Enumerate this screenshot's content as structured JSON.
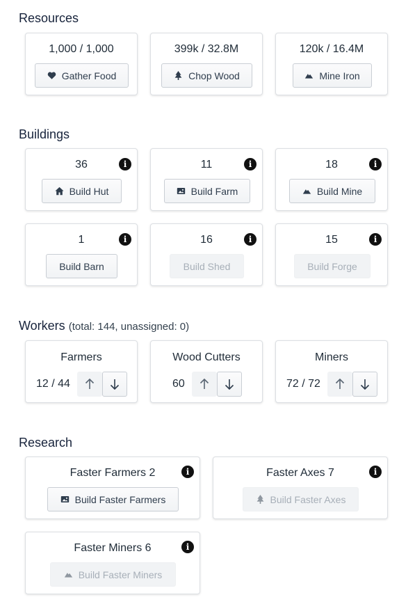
{
  "resources": {
    "title": "Resources",
    "cards": [
      {
        "count": "1,000 / 1,000",
        "button": "Gather Food",
        "icon": "heart-icon"
      },
      {
        "count": "399k / 32.8M",
        "button": "Chop Wood",
        "icon": "tree-icon"
      },
      {
        "count": "120k / 16.4M",
        "button": "Mine Iron",
        "icon": "mountain-icon"
      }
    ]
  },
  "buildings": {
    "title": "Buildings",
    "cards": [
      {
        "count": "36",
        "button": "Build Hut",
        "icon": "home-icon",
        "enabled": true
      },
      {
        "count": "11",
        "button": "Build Farm",
        "icon": "image-icon",
        "enabled": true
      },
      {
        "count": "18",
        "button": "Build Mine",
        "icon": "mountain-icon",
        "enabled": true
      },
      {
        "count": "1",
        "button": "Build Barn",
        "icon": "",
        "enabled": true
      },
      {
        "count": "16",
        "button": "Build Shed",
        "icon": "",
        "enabled": false
      },
      {
        "count": "15",
        "button": "Build Forge",
        "icon": "",
        "enabled": false
      }
    ]
  },
  "workers": {
    "title": "Workers",
    "summary": "(total: 144, unassigned: 0)",
    "cards": [
      {
        "label": "Farmers",
        "value": "12 / 44"
      },
      {
        "label": "Wood Cutters",
        "value": "60"
      },
      {
        "label": "Miners",
        "value": "72 / 72"
      }
    ]
  },
  "research": {
    "title": "Research",
    "cards": [
      {
        "title": "Faster Farmers 2",
        "button": "Build Faster Farmers",
        "icon": "image-icon",
        "enabled": true
      },
      {
        "title": "Faster Axes 7",
        "button": "Build Faster Axes",
        "icon": "tree-icon",
        "enabled": false
      },
      {
        "title": "Faster Miners 6",
        "button": "Build Faster Miners",
        "icon": "mountain-icon",
        "enabled": false
      }
    ]
  },
  "info_glyph": "i"
}
